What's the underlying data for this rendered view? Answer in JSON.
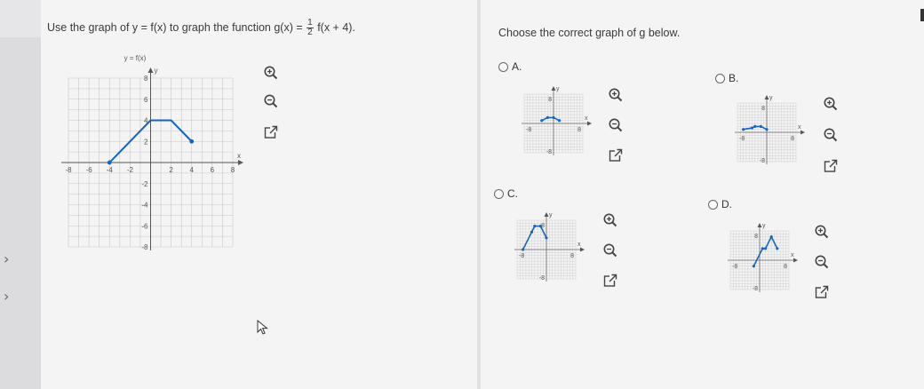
{
  "question": {
    "prefix": "Use the graph of y = f(x) to graph the function g(x) =",
    "frac_num": "1",
    "frac_den": "2",
    "suffix": "f(x + 4)."
  },
  "prompt": "Choose the correct graph of g below.",
  "main_graph": {
    "title": "y = f(x)",
    "axis_y": "y",
    "axis_x": "x",
    "xticks": [
      "-8",
      "-6",
      "-4",
      "-2",
      "2",
      "4",
      "6",
      "8"
    ],
    "yticks": [
      "8",
      "6",
      "4",
      "2",
      "-2",
      "-4",
      "-6",
      "-8"
    ],
    "points": [
      [
        -4,
        0
      ],
      [
        -1,
        3
      ],
      [
        0,
        4
      ],
      [
        2,
        4
      ],
      [
        4,
        2
      ]
    ],
    "range": [
      -8,
      8
    ],
    "line_color": "#1565c0"
  },
  "options": [
    {
      "label": "A.",
      "points": [
        [
          -4,
          1
        ],
        [
          -2,
          2
        ],
        [
          0,
          2
        ],
        [
          2,
          1
        ]
      ],
      "ticks": [
        "8",
        "-8",
        "8",
        "-8"
      ],
      "axis_y": "y",
      "axis_x": "x"
    },
    {
      "label": "B.",
      "points": [
        [
          -8,
          1
        ],
        [
          -5,
          1.5
        ],
        [
          -4,
          2
        ],
        [
          -2,
          2
        ],
        [
          0,
          1
        ]
      ],
      "ticks": [
        "8",
        "-8",
        "8",
        "-8"
      ],
      "axis_y": "y",
      "axis_x": "x"
    },
    {
      "label": "C.",
      "points": [
        [
          -8,
          0
        ],
        [
          -5,
          6
        ],
        [
          -4,
          8
        ],
        [
          -2,
          8
        ],
        [
          0,
          4
        ]
      ],
      "ticks": [
        "8",
        "-8",
        "8",
        "-8"
      ],
      "axis_y": "y",
      "axis_x": "x"
    },
    {
      "label": "D.",
      "points": [
        [
          -2,
          -2
        ],
        [
          1,
          4
        ],
        [
          2,
          4
        ],
        [
          4,
          8
        ],
        [
          6,
          4
        ]
      ],
      "ticks": [
        "8",
        "-8",
        "8",
        "-8"
      ],
      "axis_y": "y",
      "axis_x": "x"
    }
  ],
  "icons": [
    "zoom-in-icon",
    "zoom-out-icon",
    "popout-icon"
  ],
  "colors": {
    "accent": "#1565c0",
    "panel": "#f4f4f5",
    "grid": "#c8c8c8"
  }
}
